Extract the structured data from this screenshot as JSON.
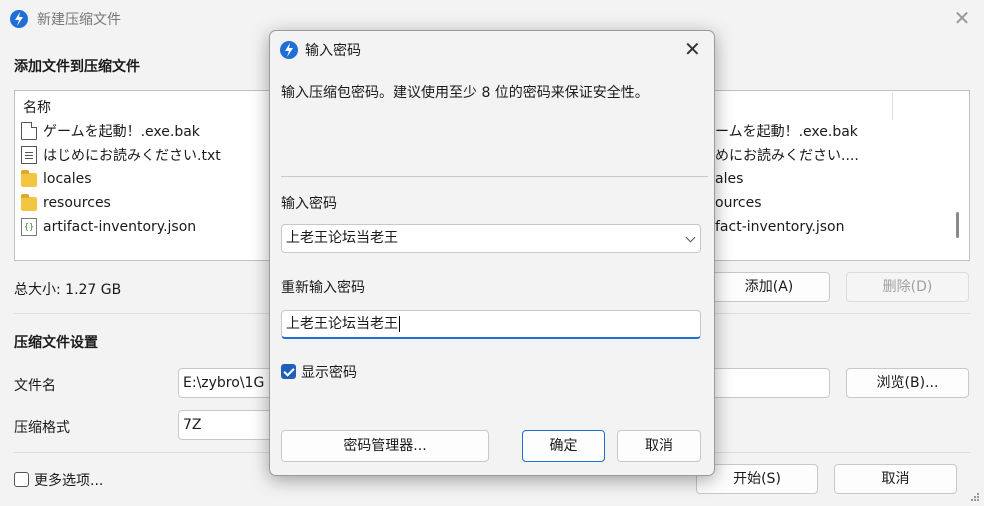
{
  "window": {
    "title": "新建压缩文件",
    "close_glyph": "✕"
  },
  "add_section": {
    "heading": "添加文件到压缩文件",
    "column_name": "名称",
    "files": [
      {
        "name": "ゲームを起動！.exe.bak",
        "icon": "file-icon"
      },
      {
        "name": "はじめにお読みください.txt",
        "icon": "text-file-icon"
      },
      {
        "name": "locales",
        "icon": "folder-icon"
      },
      {
        "name": "resources",
        "icon": "folder-icon"
      },
      {
        "name": "artifact-inventory.json",
        "icon": "json-file-icon"
      }
    ],
    "right_column": [
      "ームを起動！.exe.bak",
      "めにお読みください....",
      "ales",
      "ources",
      "fact-inventory.json"
    ],
    "total_size": "总大小: 1.27 GB",
    "add_button": "添加(A)",
    "remove_button": "删除(D)"
  },
  "settings": {
    "heading": "压缩文件设置",
    "filename_label": "文件名",
    "filename_value": "E:\\zybro\\1G",
    "browse_button": "浏览(B)...",
    "format_label": "压缩格式",
    "format_value": "7Z",
    "more_options": "更多选项...",
    "start_button": "开始(S)",
    "cancel_button": "取消"
  },
  "dialog": {
    "title": "输入密码",
    "close_glyph": "✕",
    "description": "输入压缩包密码。建议使用至少 8 位的密码来保证安全性。",
    "password_label": "输入密码",
    "password_value": "上老王论坛当老王",
    "reenter_label": "重新输入密码",
    "reenter_value": "上老王论坛当老王",
    "show_password_label": "显示密码",
    "show_password_checked": true,
    "manager_button": "密码管理器...",
    "ok_button": "确定",
    "cancel_button": "取消"
  },
  "colors": {
    "accent": "#1f6fd6",
    "folder": "#f4c542"
  }
}
